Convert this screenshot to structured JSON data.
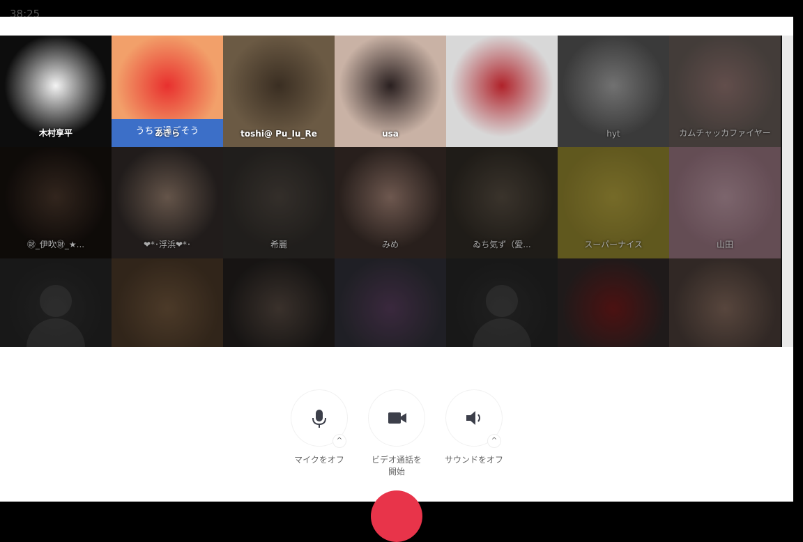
{
  "timer": "38:25",
  "participants": [
    {
      "name": "木村享平",
      "bg": "#0d0d0d",
      "accent": "#f4f4f4",
      "dim": false
    },
    {
      "name": "あきら",
      "bg": "#f2a06a",
      "accent": "#e8302e",
      "dim": false,
      "banner": "うちで過ごそう"
    },
    {
      "name": "toshi@ Pu_Iu_Re",
      "bg": "#6b5a44",
      "accent": "#3a2e22",
      "dim": false
    },
    {
      "name": "usa",
      "bg": "#c9b2a5",
      "accent": "#2a2020",
      "dim": false
    },
    {
      "name": "",
      "bg": "#d8d8d8",
      "accent": "#b0222a",
      "dim": false
    },
    {
      "name": "hyt",
      "bg": "#6a6a6a",
      "accent": "#cfcfcf",
      "dim": true
    },
    {
      "name": "カムチャッカファイヤー",
      "bg": "#7a6e68",
      "accent": "#b38e8a",
      "dim": true
    },
    {
      "name": "㊖_伊吹㊖_★...",
      "bg": "#1b1410",
      "accent": "#5b4436",
      "dim": true
    },
    {
      "name": "❤*･浮浜❤*･",
      "bg": "#3c3432",
      "accent": "#b79a86",
      "dim": true
    },
    {
      "name": "希麗",
      "bg": "#3b3733",
      "accent": "#5e554d",
      "dim": true
    },
    {
      "name": "みめ",
      "bg": "#4a3a34",
      "accent": "#c8a090",
      "dim": true
    },
    {
      "name": "ゐち気ず（愛...",
      "bg": "#3a342c",
      "accent": "#6a5e50",
      "dim": true
    },
    {
      "name": "スーパーナイス",
      "bg": "#b0a038",
      "accent": "#d6c24a",
      "dim": true
    },
    {
      "name": "山田",
      "bg": "#b78c9a",
      "accent": "#e2b8c6",
      "dim": true
    },
    {
      "name": "",
      "bg": "#2c2c2c",
      "accent": "#3a3a3a",
      "dim": true,
      "placeholder": true
    },
    {
      "name": "",
      "bg": "#5a4430",
      "accent": "#8a6a4a",
      "dim": true
    },
    {
      "name": "",
      "bg": "#2a2624",
      "accent": "#6a5a50",
      "dim": true
    },
    {
      "name": "",
      "bg": "#3a3a44",
      "accent": "#6a4a70",
      "dim": true
    },
    {
      "name": "",
      "bg": "#2c2c2c",
      "accent": "#3a3a3a",
      "dim": true,
      "placeholder": true
    },
    {
      "name": "",
      "bg": "#3a3030",
      "accent": "#8a2020",
      "dim": true
    },
    {
      "name": "",
      "bg": "#5a4a44",
      "accent": "#a08070",
      "dim": true
    }
  ],
  "controls": {
    "mic": {
      "label": "マイクをオフ",
      "icon": "microphone-icon"
    },
    "video": {
      "label": "ビデオ通話を\n開始",
      "label_line1": "ビデオ通話を",
      "label_line2": "開始",
      "icon": "video-camera-icon"
    },
    "sound": {
      "label": "サウンドをオフ",
      "icon": "speaker-icon"
    }
  },
  "colors": {
    "end_call": "#e8344a",
    "icon": "#3c3f4a"
  }
}
